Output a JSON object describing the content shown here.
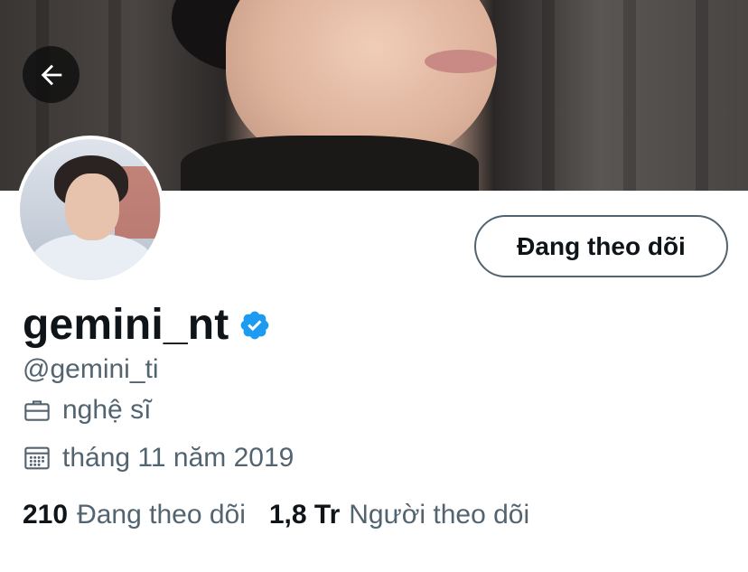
{
  "header": {
    "back_icon": "arrow-left-icon"
  },
  "profile": {
    "display_name": "gemini_nt",
    "verified_icon": "verified-badge-icon",
    "verified_color": "#1d9bf0",
    "handle": "@gemini_ti",
    "follow_button_label": "Đang theo dõi",
    "profession_icon": "briefcase-icon",
    "profession": "nghệ sĩ",
    "joined_icon": "calendar-icon",
    "joined": "tháng 11 năm 2019"
  },
  "stats": {
    "following_count": "210",
    "following_label": "Đang theo dõi",
    "followers_count": "1,8 Tr",
    "followers_label": "Người theo dõi"
  },
  "colors": {
    "text_primary": "#0f1419",
    "text_secondary": "#536471",
    "accent": "#1d9bf0"
  }
}
